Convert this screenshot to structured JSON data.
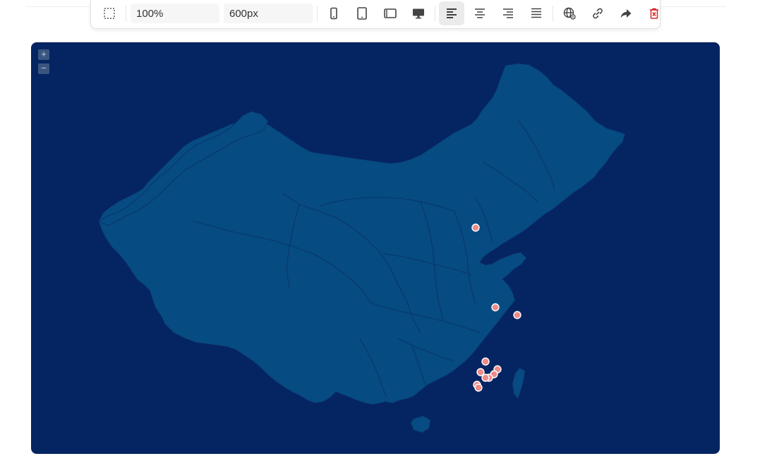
{
  "toolbar": {
    "zoom_value": "100%",
    "width_value": "600px",
    "active_align": "left"
  },
  "map": {
    "zoom_in_label": "+",
    "zoom_out_label": "−",
    "colors": {
      "background": "#052462",
      "land": "#064b82",
      "border": "#0a2f66",
      "marker_fill": "#ef8b8b",
      "marker_stroke": "#ffffff"
    }
  }
}
